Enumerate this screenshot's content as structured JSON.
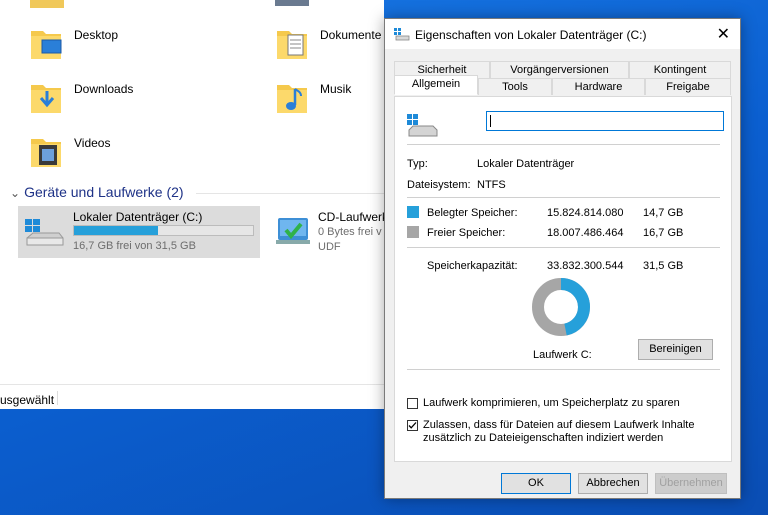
{
  "explorer": {
    "folders": [
      {
        "label": "Desktop"
      },
      {
        "label": "Dokumente"
      },
      {
        "label": "Downloads"
      },
      {
        "label": "Musik"
      },
      {
        "label": "Videos"
      }
    ],
    "group_header": "Geräte und Laufwerke (2)",
    "drives": [
      {
        "name": "Lokaler Datenträger (C:)",
        "free_text": "16,7 GB frei von 31,5 GB",
        "used_fraction": 0.467
      },
      {
        "name": "CD-Laufwerk",
        "free_text": "0 Bytes frei v",
        "fs": "UDF"
      }
    ],
    "status_text": "usgewählt"
  },
  "dialog": {
    "title": "Eigenschaften von Lokaler Datenträger (C:)",
    "close_glyph": "✕",
    "tabs_row1": [
      "Sicherheit",
      "Vorgängerversionen",
      "Kontingent"
    ],
    "tabs_row2": [
      "Allgemein",
      "Tools",
      "Hardware",
      "Freigabe"
    ],
    "active_tab": "Allgemein",
    "name_value": "",
    "type_label": "Typ:",
    "type_value": "Lokaler Datenträger",
    "fs_label": "Dateisystem:",
    "fs_value": "NTFS",
    "used_label": "Belegter Speicher:",
    "used_bytes": "15.824.814.080",
    "used_gb": "14,7 GB",
    "free_label": "Freier Speicher:",
    "free_bytes": "18.007.486.464",
    "free_gb": "16,7 GB",
    "cap_label": "Speicherkapazität:",
    "cap_bytes": "33.832.300.544",
    "cap_gb": "31,5 GB",
    "drive_caption": "Laufwerk C:",
    "cleanup_button": "Bereinigen",
    "compress_label": "Laufwerk komprimieren, um Speicherplatz zu sparen",
    "compress_checked": false,
    "index_label_line1": "Zulassen, dass für Dateien auf diesem Laufwerk Inhalte",
    "index_label_line2": "zusätzlich zu Dateieigenschaften indiziert werden",
    "index_checked": true,
    "ok_button": "OK",
    "cancel_button": "Abbrechen",
    "apply_button": "Übernehmen",
    "colors": {
      "used": "#26a0da",
      "free": "#a6a6a6"
    },
    "used_fraction": 0.4677
  }
}
